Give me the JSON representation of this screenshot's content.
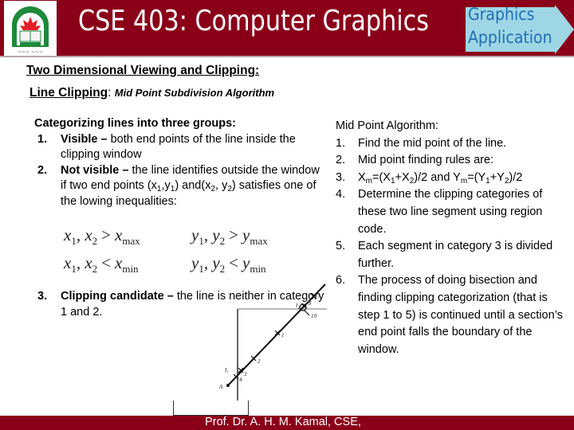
{
  "header": {
    "title": "CSE 403: Computer Graphics",
    "logo_label": "university-logo",
    "arrow_label_line1": "Graphics",
    "arrow_label_line2": "Application"
  },
  "colors": {
    "header_bg": "#8b0019",
    "arrow_fill": "#9ed6e6",
    "arrow_text": "#1f6eb0"
  },
  "section": {
    "heading": "Two Dimensional Viewing and Clipping:",
    "subheading_bold": "Line Clipping",
    "subheading_sep": ":",
    "subheading_italic": "Mid Point Subdivision Algorithm"
  },
  "left": {
    "lead": "Categorizing lines into three groups:",
    "items": [
      {
        "num": "1.",
        "term": "Visible",
        "dash": " – ",
        "text": "both end points of the line inside the clipping window"
      },
      {
        "num": "2.",
        "term": "Not visible",
        "dash": " – ",
        "text_a": "the line identifies outside the window if two end points (x",
        "s1": "1",
        "text_b": ",y",
        "s2": "1",
        "text_c": ") and(x",
        "s3": "2",
        "text_d": ", y",
        "s4": "2",
        "text_e": ") satisfies one of the lowing inequalities:"
      },
      {
        "num": "3.",
        "term": "Clipping candidate",
        "dash": " – ",
        "text": "the line is neither in category 1 and 2."
      }
    ],
    "inequalities": [
      {
        "lhs_a": "x",
        "lhs_a_sub": "1",
        "sep": ", ",
        "lhs_b": "x",
        "lhs_b_sub": "2",
        "op": ">",
        "rhs": "x",
        "rhs_sub": "max"
      },
      {
        "lhs_a": "y",
        "lhs_a_sub": "1",
        "sep": ", ",
        "lhs_b": "y",
        "lhs_b_sub": "2",
        "op": ">",
        "rhs": "y",
        "rhs_sub": "max"
      },
      {
        "lhs_a": "x",
        "lhs_a_sub": "1",
        "sep": ", ",
        "lhs_b": "x",
        "lhs_b_sub": "2",
        "op": "<",
        "rhs": "x",
        "rhs_sub": "min"
      },
      {
        "lhs_a": "y",
        "lhs_a_sub": "1",
        "sep": ", ",
        "lhs_b": "y",
        "lhs_b_sub": "2",
        "op": "<",
        "rhs": "y",
        "rhs_sub": "min"
      }
    ]
  },
  "right": {
    "lead": "Mid Point Algorithm:",
    "items": [
      {
        "num": "1.",
        "text": "Find the mid point of the line."
      },
      {
        "num": "2.",
        "text": "Mid point finding rules are:"
      },
      {
        "num": "3.",
        "formula": {
          "a": "X",
          "a_sub": "m",
          "b": "=(X",
          "b_sub": "1",
          "c": "+X",
          "c_sub": "2",
          "d": ")/2 and Y",
          "d_sub": "m",
          "e": "=(Y",
          "e_sub": "1",
          "f": "+Y",
          "f_sub": "2",
          "g": ")/2"
        }
      },
      {
        "num": "4.",
        "text": "Determine the clipping categories of these two line segment using region code."
      },
      {
        "num": "5.",
        "text": "Each segment in category 3 is divided further."
      },
      {
        "num": "6.",
        "text": "The process of doing bisection and finding clipping categorization (that is step 1 to 5)  is continued until a section’s end point falls the boundary of the window."
      }
    ]
  },
  "diagram": {
    "point_labels": [
      "A",
      "1",
      "2",
      "3",
      "4",
      "7",
      "8",
      "10",
      "I₁",
      "I₂"
    ]
  },
  "footer": {
    "text": "Prof. Dr. A. H. M. Kamal, CSE,"
  }
}
